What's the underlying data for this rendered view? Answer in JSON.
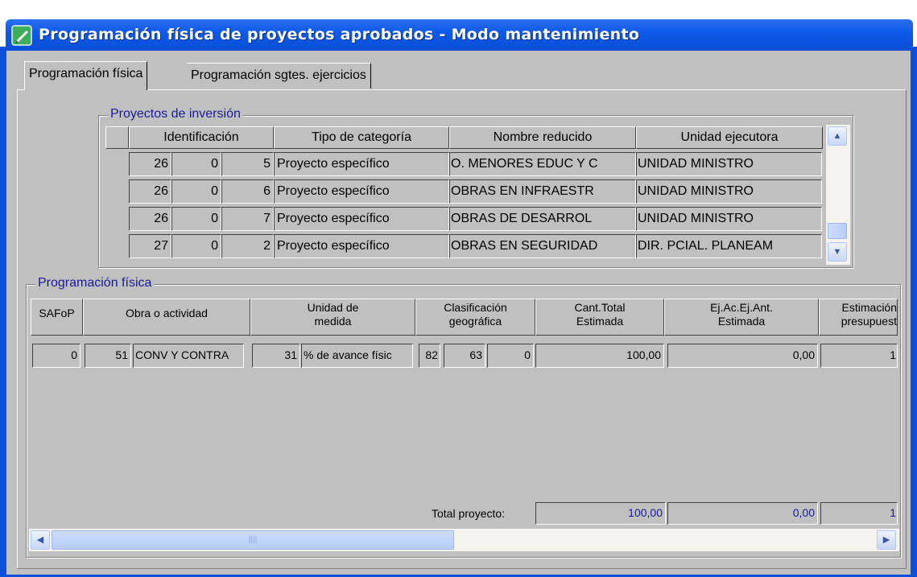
{
  "window": {
    "title": "Programación física de proyectos aprobados - Modo mantenimiento"
  },
  "tabs": [
    {
      "label": "Programación física",
      "active": true
    },
    {
      "label": "Programación sgtes. ejercicios",
      "active": false
    }
  ],
  "proyectos": {
    "group_label": "Proyectos de inversión",
    "columns": [
      "Identificación",
      "Tipo de categoría",
      "Nombre reducido",
      "Unidad ejecutora"
    ],
    "rows": [
      {
        "id1": "26",
        "id2": "0",
        "id3": "5",
        "tipo": "Proyecto específico",
        "nombre": "O. MENORES EDUC Y C",
        "unidad": "UNIDAD MINISTRO"
      },
      {
        "id1": "26",
        "id2": "0",
        "id3": "6",
        "tipo": "Proyecto específico",
        "nombre": "OBRAS EN INFRAESTR",
        "unidad": "UNIDAD MINISTRO"
      },
      {
        "id1": "26",
        "id2": "0",
        "id3": "7",
        "tipo": "Proyecto específico",
        "nombre": "OBRAS DE DESARROL",
        "unidad": "UNIDAD MINISTRO"
      },
      {
        "id1": "27",
        "id2": "0",
        "id3": "2",
        "tipo": "Proyecto específico",
        "nombre": "OBRAS EN SEGURIDAD",
        "unidad": "DIR. PCIAL. PLANEAM"
      }
    ]
  },
  "programacion": {
    "group_label": "Programación física",
    "columns": {
      "safop": "SAFoP",
      "obra": "Obra o actividad",
      "unidad_l1": "Unidad de",
      "unidad_l2": "medida",
      "clasif_l1": "Clasificación",
      "clasif_l2": "geográfica",
      "cant_l1": "Cant.Total",
      "cant_l2": "Estimada",
      "ejac_l1": "Ej.Ac.Ej.Ant.",
      "ejac_l2": "Estimada",
      "estim_l1": "Estimación",
      "estim_l2": "presupuest"
    },
    "row": {
      "safop": "0",
      "obra_num": "51",
      "obra_desc": "CONV Y CONTRA",
      "unidad_num": "31",
      "unidad_desc": "% de avance físic",
      "geo1": "82",
      "geo2": "63",
      "geo3": "0",
      "cant_total": "100,00",
      "ej_ac": "0,00",
      "estimacion": "1"
    },
    "total": {
      "label": "Total proyecto:",
      "cant_total": "100,00",
      "ej_ac": "0,00",
      "estimacion": "1"
    }
  },
  "colors": {
    "title_bar": "#0c58e8",
    "face": "#c0c0c0",
    "group_label": "#1a1a9a",
    "total_value": "#1a1a9a"
  }
}
